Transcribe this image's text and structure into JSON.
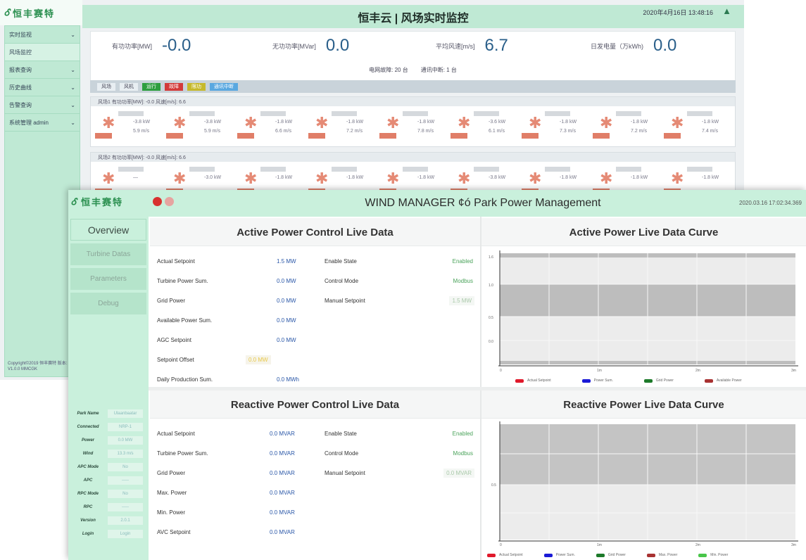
{
  "back": {
    "logo_mark": "Ꮄ",
    "logo_cn": "恒丰赛特",
    "title": "恒丰云 | 风场实时监控",
    "datetime": "2020年4月16日 13:48:16",
    "sidebar": [
      {
        "label": "实时监视"
      },
      {
        "label": "风场监控"
      },
      {
        "label": "报表查询"
      },
      {
        "label": "历史曲线"
      },
      {
        "label": "告警查询"
      },
      {
        "label": "系统管理 admin"
      }
    ],
    "copyright": "Copyright©2019 恒丰赛特 版本: V1.0.0 MMCGK",
    "kpis": [
      {
        "label": "有功功率[MW]",
        "value": "-0.0"
      },
      {
        "label": "无功功率[MVar]",
        "value": "0.0"
      },
      {
        "label": "平均风速[m/s]",
        "value": "6.7"
      },
      {
        "label": "日发电量（万kWh)",
        "value": "0.0"
      }
    ],
    "kpi_sub": [
      "电网故障: 20 台",
      "通讯中断: 1 台"
    ],
    "toolbar": {
      "sel1": "风场",
      "sel2": "风机",
      "pills": [
        {
          "label": "运行",
          "color": "#2e9e3f"
        },
        {
          "label": "故障",
          "color": "#d33a3a"
        },
        {
          "label": "限功",
          "color": "#c6b92c"
        },
        {
          "label": "通讯中断",
          "color": "#5aa8e0"
        }
      ]
    },
    "farm1_head": "风场1  有功功率[MW]: -0.0   风速[m/s]: 6.6",
    "farm2_head": "风场2  有功功率[MW]: -0.0   风速[m/s]: 6.6",
    "farm1_turbines": [
      {
        "kw": "-3.8 kW",
        "ws": "5.9 m/s"
      },
      {
        "kw": "-3.8 kW",
        "ws": "5.9 m/s"
      },
      {
        "kw": "-1.8 kW",
        "ws": "6.6 m/s"
      },
      {
        "kw": "-1.8 kW",
        "ws": "7.2 m/s"
      },
      {
        "kw": "-1.8 kW",
        "ws": "7.8 m/s"
      },
      {
        "kw": "-3.6 kW",
        "ws": "6.1 m/s"
      },
      {
        "kw": "-1.8 kW",
        "ws": "7.3 m/s"
      },
      {
        "kw": "-1.8 kW",
        "ws": "7.2 m/s"
      },
      {
        "kw": "-1.8 kW",
        "ws": "7.4 m/s"
      }
    ],
    "farm2_turbines": [
      {
        "kw": "—",
        "ws": ""
      },
      {
        "kw": "-3.0 kW",
        "ws": ""
      },
      {
        "kw": "-1.8 kW",
        "ws": ""
      },
      {
        "kw": "-1.8 kW",
        "ws": ""
      },
      {
        "kw": "-1.8 kW",
        "ws": ""
      },
      {
        "kw": "-3.8 kW",
        "ws": ""
      },
      {
        "kw": "-1.8 kW",
        "ws": ""
      },
      {
        "kw": "-1.8 kW",
        "ws": ""
      },
      {
        "kw": "-1.8 kW",
        "ws": ""
      }
    ]
  },
  "front": {
    "logo_mark": "Ꮄ",
    "logo_cn": "恒丰赛特",
    "title": "WIND MANAGER ¢ó Park Power Management",
    "datetime": "2020.03.16 17:02:34.369",
    "nav": [
      {
        "label": "Overview",
        "active": true
      },
      {
        "label": "Turbine Datas",
        "active": false
      },
      {
        "label": "Parameters",
        "active": false
      },
      {
        "label": "Debug",
        "active": false
      }
    ],
    "status": [
      {
        "key": "Park Name",
        "value": "Ulaanbaatar"
      },
      {
        "key": "Connected",
        "value": "NRP-1"
      },
      {
        "key": "Power",
        "value": "0.0 MW"
      },
      {
        "key": "Wind",
        "value": "13.3 m/s"
      },
      {
        "key": "APC Mode",
        "value": "No"
      },
      {
        "key": "APC",
        "value": "-----"
      },
      {
        "key": "RPC Mode",
        "value": "No"
      },
      {
        "key": "RPC",
        "value": "-----"
      },
      {
        "key": "Version",
        "value": "2.0.1"
      },
      {
        "key": "Login",
        "value": "Login"
      }
    ],
    "apc": {
      "title": "Active Power Control Live Data",
      "left": [
        {
          "label": "Actual Setpoint",
          "value": "1.5 MW"
        },
        {
          "label": "Turbine Power Sum.",
          "value": "0.0 MW"
        },
        {
          "label": "Grid Power",
          "value": "0.0 MW"
        },
        {
          "label": "Available Power Sum.",
          "value": "0.0 MW"
        },
        {
          "label": "AGC Setpoint",
          "value": "0.0 MW"
        },
        {
          "label": "Setpoint Offset",
          "value": "0.0 MW"
        },
        {
          "label": "Daily Production Sum.",
          "value": "0.0 MWh"
        }
      ],
      "right": [
        {
          "label": "Enable State",
          "value": "Enabled"
        },
        {
          "label": "Control Mode",
          "value": "Modbus"
        },
        {
          "label": "Manual Setpoint",
          "value": "1.5 MW"
        }
      ]
    },
    "apc_curve": {
      "title": "Active Power Live Data Curve",
      "legend": [
        "Actual Setpoint",
        "Power Sum.",
        "Grid Power",
        "Available Power"
      ],
      "y_ticks": [
        "1.6",
        "1.0",
        "0.5",
        "0.0"
      ],
      "x_ticks": [
        "0",
        "1m",
        "2m",
        "3m"
      ]
    },
    "rpc": {
      "title": "Reactive Power Control Live Data",
      "left": [
        {
          "label": "Actual Setpoint",
          "value": "0.0 MVAR"
        },
        {
          "label": "Turbine Power Sum.",
          "value": "0.0 MVAR"
        },
        {
          "label": "Grid Power",
          "value": "0.0 MVAR"
        },
        {
          "label": "Max. Power",
          "value": "0.0 MVAR"
        },
        {
          "label": "Min. Power",
          "value": "0.0 MVAR"
        },
        {
          "label": "AVC Setpoint",
          "value": "0.0 MVAR"
        }
      ],
      "right": [
        {
          "label": "Enable State",
          "value": "Enabled"
        },
        {
          "label": "Control Mode",
          "value": "Modbus"
        },
        {
          "label": "Manual Setpoint",
          "value": "0.0 MVAR"
        }
      ]
    },
    "rpc_curve": {
      "title": "Reactive Power Live Data Curve",
      "legend": [
        "Actual Setpoint",
        "Power Sum.",
        "Grid Power",
        "Max. Power",
        "Min. Power"
      ],
      "y_ticks": [
        "0.5"
      ],
      "x_ticks": [
        "0",
        "1m",
        "2m",
        "3m"
      ]
    }
  }
}
